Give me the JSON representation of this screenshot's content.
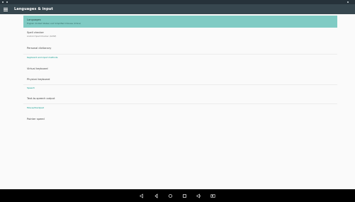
{
  "app_bar": {
    "title": "Languages & input",
    "menu_icon": "hamburger-menu-icon"
  },
  "items": [
    {
      "title": "Languages",
      "summary": "English (United States) and Simplified Chinese (China)",
      "selected": true
    },
    {
      "title": "Spell checker",
      "summary": "Android Spell Checker (AOSP)",
      "selected": false
    },
    {
      "title": "Personal dictionary",
      "summary": "",
      "selected": false
    }
  ],
  "headers": {
    "keyboard": "Keyboard and input methods",
    "speech": "Speech",
    "mouse": "Mouse/trackpad"
  },
  "keyboard_items": [
    {
      "title": "Virtual keyboard"
    },
    {
      "title": "Physical keyboard"
    }
  ],
  "speech_items": [
    {
      "title": "Text-to-speech output"
    }
  ],
  "mouse_items": [
    {
      "title": "Pointer speed"
    }
  ],
  "nav_bar": {
    "buttons": [
      "volume-down-icon",
      "back-icon",
      "home-icon",
      "recents-icon",
      "volume-up-icon",
      "screenshot-icon"
    ]
  },
  "colors": {
    "app_bar": "#37474f",
    "status_bar": "#26323a",
    "selected": "#80cbc4",
    "accent": "#009688"
  }
}
